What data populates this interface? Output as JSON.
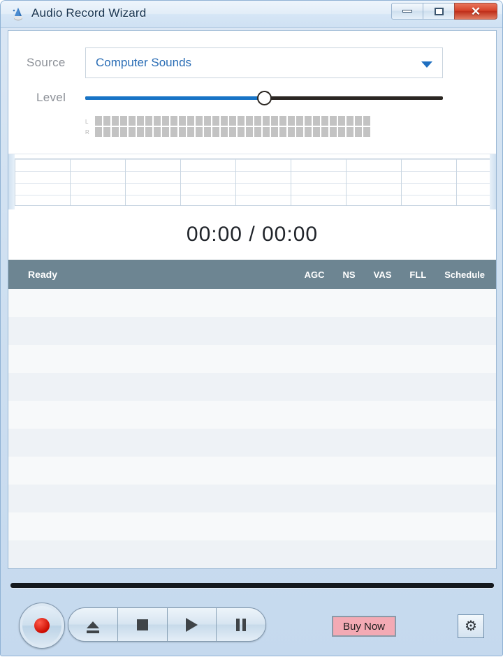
{
  "window": {
    "title": "Audio Record Wizard",
    "icon": "wizard-icon",
    "controls": {
      "minimize": "minimize-icon",
      "maximize": "maximize-icon",
      "close": "✕"
    }
  },
  "source": {
    "label": "Source",
    "value": "Computer Sounds",
    "arrow_icon": "chevron-down-icon"
  },
  "level": {
    "label": "Level",
    "value_percent": 50,
    "fill_color": "#1874c6",
    "track_color": "#2b2622"
  },
  "meters": {
    "left_label": "L",
    "right_label": "R",
    "segment_count": 33,
    "segment_color": "#c3c3c3"
  },
  "time": {
    "display": "00:00 / 00:00"
  },
  "status": {
    "text": "Ready",
    "background": "#6d8592",
    "toggles": [
      "AGC",
      "NS",
      "VAS",
      "FLL",
      "Schedule"
    ]
  },
  "filelist": {
    "row_count": 11,
    "rows": []
  },
  "footer": {
    "record_label": "record-button",
    "transport": [
      {
        "name": "eject",
        "icon": "eject-icon"
      },
      {
        "name": "stop",
        "icon": "stop-icon"
      },
      {
        "name": "play",
        "icon": "play-icon"
      },
      {
        "name": "pause",
        "icon": "pause-icon"
      }
    ],
    "buy_now": "Buy Now",
    "buy_now_color": "#f3aab4",
    "settings_icon": "⚙"
  }
}
